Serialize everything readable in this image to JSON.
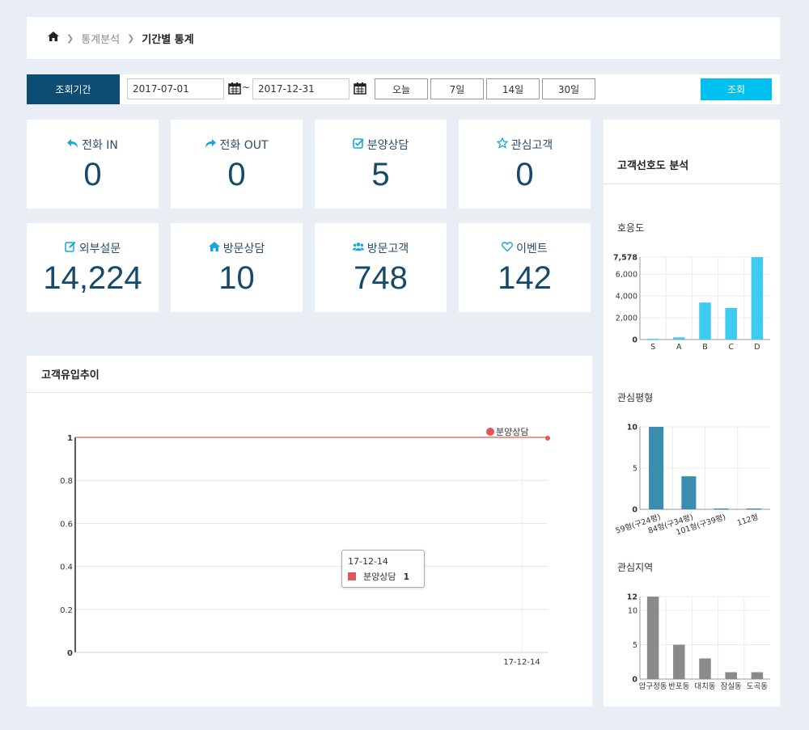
{
  "breadcrumb": {
    "level1": "통계분석",
    "level2": "기간별 통계"
  },
  "filter": {
    "period_label": "조회기간",
    "start_date": "2017-07-01",
    "end_date": "2017-12-31",
    "tilde": "~",
    "quick_buttons": [
      "오늘",
      "7일",
      "14일",
      "30일"
    ],
    "search_label": "조회"
  },
  "stats": [
    {
      "label": "전화 IN",
      "value": "0",
      "icon": "reply-icon"
    },
    {
      "label": "전화 OUT",
      "value": "0",
      "icon": "share-icon"
    },
    {
      "label": "분양상담",
      "value": "5",
      "icon": "check-square-icon"
    },
    {
      "label": "관심고객",
      "value": "0",
      "icon": "star-icon"
    },
    {
      "label": "외부설문",
      "value": "14,224",
      "icon": "edit-icon"
    },
    {
      "label": "방문상담",
      "value": "10",
      "icon": "home-icon"
    },
    {
      "label": "방문고객",
      "value": "748",
      "icon": "users-icon"
    },
    {
      "label": "이벤트",
      "value": "142",
      "icon": "heart-icon"
    }
  ],
  "colors": {
    "accent": "#00c0f0",
    "navy": "#0d4c73",
    "value_text": "#164a6b",
    "line": "#e15759",
    "pref_bar": "#3ecbf0",
    "type_bar": "#3b8db0",
    "region_bar": "#8a8a8a"
  },
  "trend": {
    "title": "고객유입추이",
    "tooltip": {
      "date": "17-12-14",
      "series": "분양상담",
      "value": "1"
    }
  },
  "side": {
    "title": "고객선호도 분석",
    "pref_title": "호응도",
    "type_title": "관심평형",
    "region_title": "관심지역"
  },
  "chart_data": [
    {
      "type": "line",
      "x": [
        "17-12-14"
      ],
      "series": [
        {
          "name": "분양상담",
          "values": [
            1
          ]
        }
      ],
      "ylim": [
        0,
        1
      ],
      "yticks": [
        "0",
        "0.2",
        "0.4",
        "0.6",
        "0.8",
        "1"
      ],
      "legend": "top-right",
      "grid": true
    },
    {
      "type": "bar",
      "categories": [
        "S",
        "A",
        "B",
        "C",
        "D"
      ],
      "values": [
        60,
        200,
        3400,
        2900,
        7578
      ],
      "ylim": [
        0,
        7578
      ],
      "yticks": [
        "0",
        "2,000",
        "4,000",
        "6,000",
        "7,578"
      ],
      "grid": true
    },
    {
      "type": "bar",
      "categories": [
        "59형(구24평)",
        "84형(구34평)",
        "101형(구39평)",
        "112형"
      ],
      "values": [
        10,
        4,
        0.1,
        0.1
      ],
      "ylim": [
        0,
        10
      ],
      "yticks": [
        "0",
        "5",
        "10"
      ],
      "grid": true
    },
    {
      "type": "bar",
      "categories": [
        "압구정동",
        "반포동",
        "대치동",
        "잠실동",
        "도곡동"
      ],
      "values": [
        12,
        5,
        3,
        1,
        1
      ],
      "ylim": [
        0,
        12
      ],
      "yticks": [
        "0",
        "5",
        "10",
        "12"
      ],
      "grid": true
    }
  ]
}
